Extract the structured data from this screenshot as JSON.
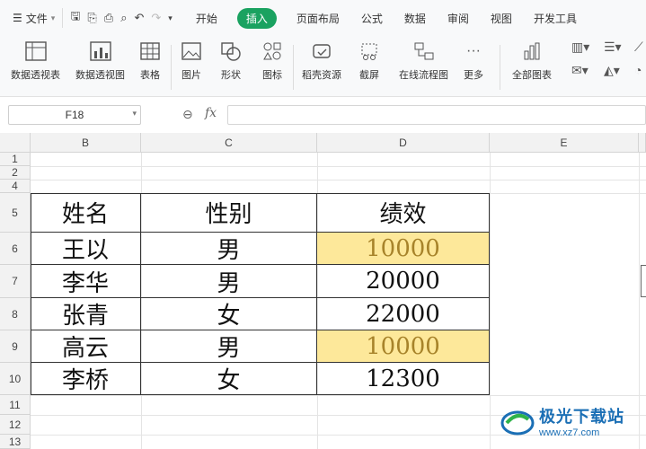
{
  "menu": {
    "file_label": "文件",
    "tabs": [
      "开始",
      "插入",
      "页面布局",
      "公式",
      "数据",
      "审阅",
      "视图",
      "开发工具"
    ],
    "active_tab": "插入"
  },
  "ribbon": {
    "buttons": [
      "数据透视表",
      "数据透视图",
      "表格",
      "图片",
      "形状",
      "图标",
      "稻壳资源",
      "截屏",
      "在线流程图",
      "更多",
      "全部图表"
    ]
  },
  "formula_bar": {
    "cell_ref": "F18",
    "fx_label": "fx",
    "formula": ""
  },
  "sheet": {
    "columns": [
      "B",
      "C",
      "D",
      "E"
    ],
    "rows": [
      "1",
      "2",
      "4",
      "5",
      "6",
      "7",
      "8",
      "9",
      "10",
      "11",
      "12",
      "13"
    ],
    "header": [
      "姓名",
      "性别",
      "绩效"
    ],
    "data": [
      [
        "王以",
        "男",
        "10000"
      ],
      [
        "李华",
        "男",
        "20000"
      ],
      [
        "张青",
        "女",
        "22000"
      ],
      [
        "高云",
        "男",
        "10000"
      ],
      [
        "李桥",
        "女",
        "12300"
      ]
    ],
    "highlight_color": "#fde89a"
  },
  "watermark": {
    "title": "极光下载站",
    "url": "www.xz7.com"
  }
}
